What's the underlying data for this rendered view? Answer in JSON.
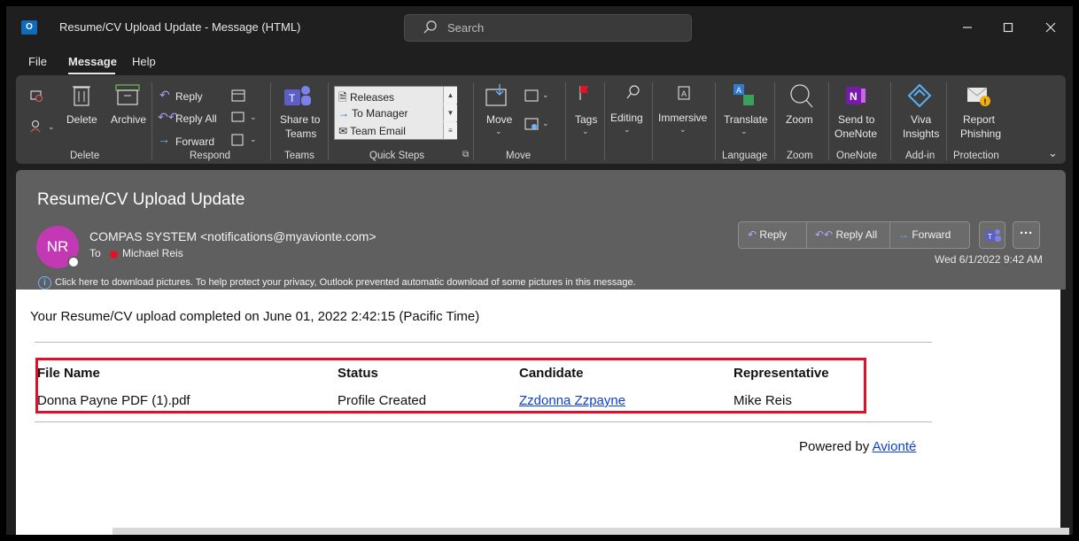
{
  "window": {
    "title": "Resume/CV Upload Update  -  Message (HTML)",
    "search_placeholder": "Search",
    "app_icon_letter": "O"
  },
  "menu": {
    "tabs": [
      "File",
      "Message",
      "Help"
    ],
    "active_tab": "Message"
  },
  "ribbon": {
    "groups": {
      "delete": "Delete",
      "respond": "Respond",
      "teams": "Teams",
      "quick_steps": "Quick Steps",
      "move": "Move",
      "language": "Language",
      "zoom": "Zoom",
      "onenote": "OneNote",
      "addin": "Add-in",
      "protection": "Protection"
    },
    "buttons": {
      "delete": "Delete",
      "archive": "Archive",
      "reply": "Reply",
      "reply_all": "Reply All",
      "forward": "Forward",
      "share_to_teams_1": "Share to",
      "share_to_teams_2": "Teams",
      "move": "Move",
      "tags": "Tags",
      "editing": "Editing",
      "immersive": "Immersive",
      "translate": "Translate",
      "zoom": "Zoom",
      "send_onenote_1": "Send to",
      "send_onenote_2": "OneNote",
      "viva_1": "Viva",
      "viva_2": "Insights",
      "report_1": "Report",
      "report_2": "Phishing"
    },
    "quick_steps": [
      "Releases",
      "To Manager",
      "Team Email"
    ]
  },
  "email": {
    "subject": "Resume/CV Upload Update",
    "avatar_initials": "NR",
    "sender": "COMPAS SYSTEM <notifications@myavionte.com>",
    "to_label": "To",
    "recipient": "Michael Reis",
    "date": "Wed 6/1/2022 9:42 AM",
    "info_bar": "Click here to download pictures. To help protect your privacy, Outlook prevented automatic download of some pictures in this message.",
    "actions": {
      "reply": "Reply",
      "reply_all": "Reply All",
      "forward": "Forward"
    }
  },
  "body": {
    "message": "Your Resume/CV upload completed on June 01, 2022 2:42:15 (Pacific Time)",
    "table": {
      "headers": [
        "File Name",
        "Status",
        "Candidate",
        "Representative"
      ],
      "rows": [
        [
          "Donna Payne PDF (1).pdf",
          "Profile Created",
          "Zzdonna Zzpayne",
          "Mike Reis"
        ]
      ]
    },
    "powered_by_prefix": "Powered by",
    "powered_by_link": "Avionté"
  },
  "colors": {
    "avatar": "#c239b3",
    "highlight_border": "#e0102a",
    "link": "#0b3fd6",
    "presence_red": "#e81123"
  }
}
